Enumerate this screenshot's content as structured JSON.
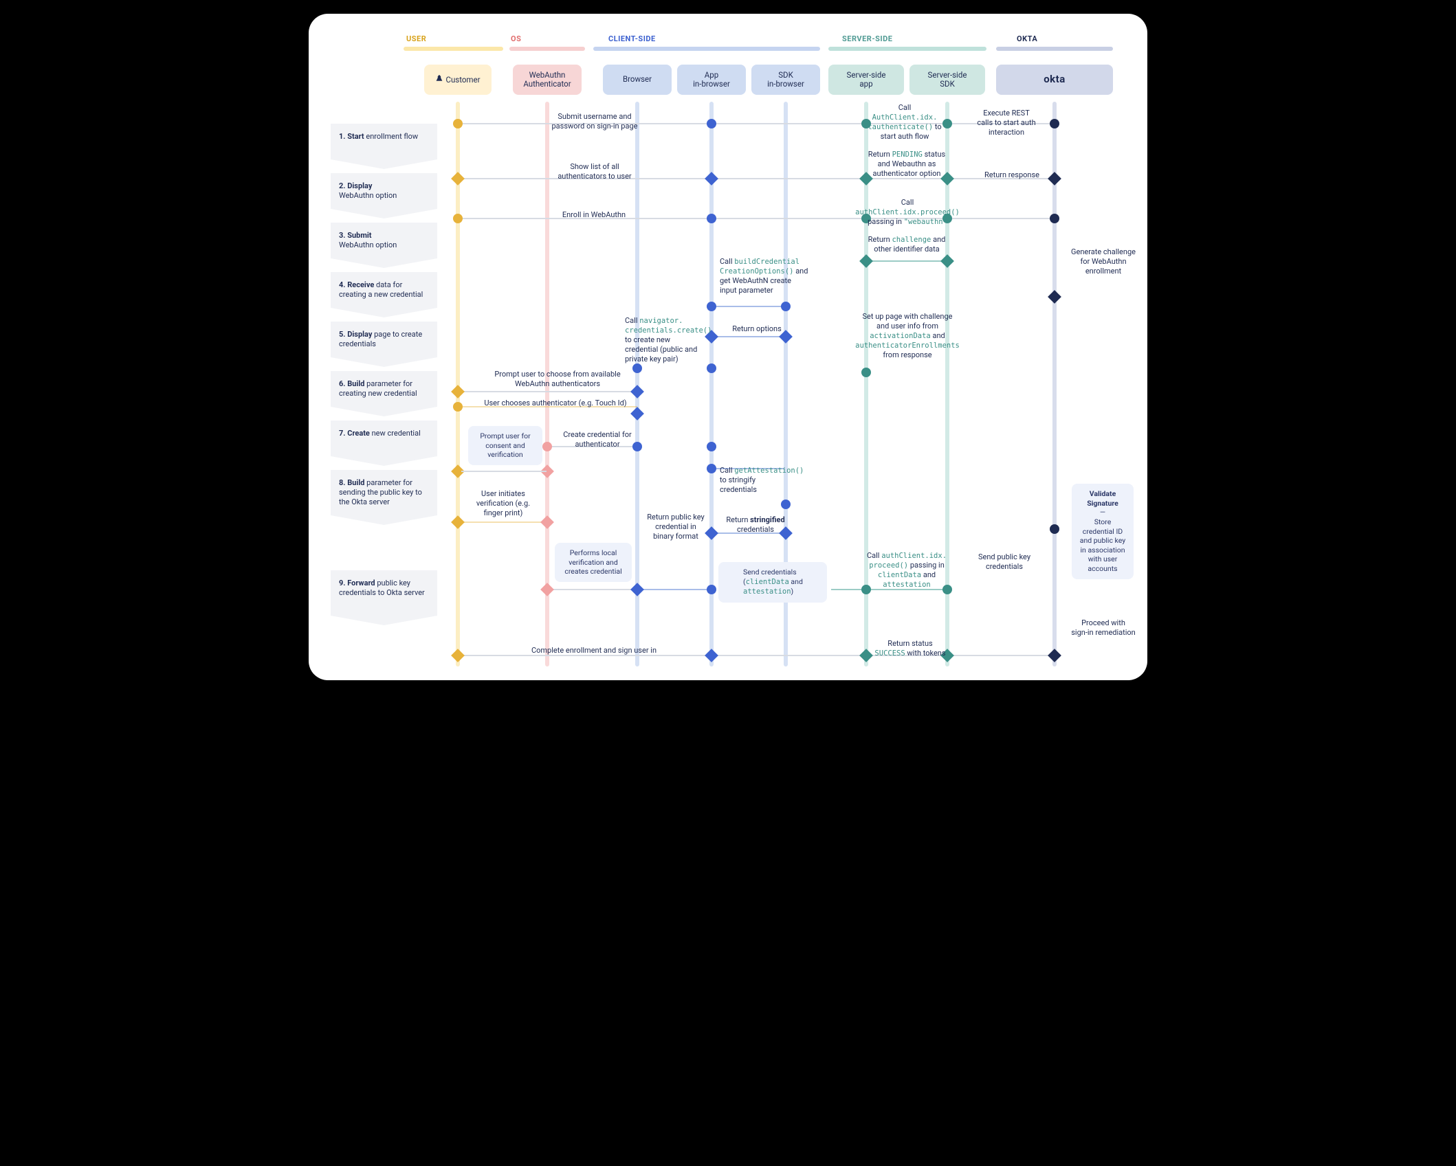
{
  "sections": {
    "user": {
      "label": "USER"
    },
    "os": {
      "label": "OS"
    },
    "client": {
      "label": "CLIENT-SIDE"
    },
    "server": {
      "label": "SERVER-SIDE"
    },
    "okta": {
      "label": "OKTA"
    }
  },
  "lanes": {
    "customer": {
      "label1": "Customer",
      "label2": ""
    },
    "webauthn": {
      "label1": "WebAuthn",
      "label2": "Authenticator"
    },
    "browser": {
      "label1": "Browser",
      "label2": ""
    },
    "app": {
      "label1": "App",
      "label2": "in-browser"
    },
    "sdk": {
      "label1": "SDK",
      "label2": "in-browser"
    },
    "serverapp": {
      "label1": "Server-side",
      "label2": "app"
    },
    "serversdk": {
      "label1": "Server-side",
      "label2": "SDK"
    },
    "okta": {
      "label1": "okta",
      "label2": ""
    }
  },
  "steps": [
    {
      "num": "1.",
      "bold": "Start",
      "rest": " enrollment flow"
    },
    {
      "num": "2.",
      "bold": "Display",
      "rest": " WebAuthn option"
    },
    {
      "num": "3.",
      "bold": "Submit",
      "rest": " WebAuthn option"
    },
    {
      "num": "4.",
      "bold": "Receive",
      "rest": " data for creating a new credential"
    },
    {
      "num": "5.",
      "bold": "Display",
      "rest": " page to create credentials"
    },
    {
      "num": "6.",
      "bold": "Build",
      "rest": " parameter for creating new credential"
    },
    {
      "num": "7.",
      "bold": "Create",
      "rest": " new credential"
    },
    {
      "num": "8.",
      "bold": "Build",
      "rest": " parameter for sending the public key to the Okta server"
    },
    {
      "num": "9.",
      "bold": "Forward",
      "rest": " public key credentials to Okta server"
    }
  ],
  "ann": {
    "a1": {
      "t1": "Submit username and",
      "t2": "password on sign-in page"
    },
    "a2": {
      "t1": "Call",
      "c1": "AuthClient.idx.",
      "c2": "tauthenticate()",
      "t2": " to",
      "t3": "start auth flow"
    },
    "a3": {
      "t1": "Execute REST",
      "t2": "calls to start auth",
      "t3": "interaction"
    },
    "a4": {
      "t1": "Return ",
      "c1": "PENDING",
      "t2": " status",
      "t3": "and Webauthn as",
      "t4": "authenticator option"
    },
    "a5": {
      "t1": "Show list of all",
      "t2": "authenticators to user"
    },
    "a6": {
      "t1": "Return response"
    },
    "a7": {
      "t1": "Enroll in WebAuthn"
    },
    "a8": {
      "t1": "Call ",
      "c1": "authClient.idx.proceed()",
      "t2": "passing in ",
      "c2": "\"webauthn\""
    },
    "a9": {
      "t1": "Generate challenge",
      "t2": "for WebAuthn",
      "t3": "enrollment"
    },
    "a10": {
      "t1": "Return ",
      "c1": "challenge",
      "t2": " and",
      "t3": "other identifier data"
    },
    "a11": {
      "t1": "Call ",
      "c1": "buildCredential",
      "c2": "CreationOptions()",
      "t2": " and",
      "t3": "get WebAuthN create",
      "t4": "input parameter"
    },
    "a12": {
      "t1": "Set up page with challenge",
      "t2": "and user info from",
      "c1": "activationData",
      "t3": " and",
      "c2": "authenticatorEnrollments",
      "t4": "from response"
    },
    "a13": {
      "t1": "Return options"
    },
    "a14": {
      "t1": "Call ",
      "c1": "navigator.",
      "c2": "credentials.create()",
      "t2": "to create new",
      "t3": "credential (public and",
      "t4": "private key pair)"
    },
    "a15": {
      "t1": "Prompt user to choose from available",
      "t2": "WebAuthn authenticators"
    },
    "a16": {
      "t1": "User chooses authenticator (e.g. Touch Id)"
    },
    "a17": {
      "t1": "Create credential for",
      "t2": "authenticator"
    },
    "a18": {
      "t1": "User initiates",
      "t2": "verification (e.g.",
      "t3": "finger print)"
    },
    "a19": {
      "t1": "Return public key",
      "t2": "credential in",
      "t3": "binary format"
    },
    "a20": {
      "t1": "Call ",
      "c1": "getAttestation()",
      "t2": "to stringify",
      "t3": "credentials"
    },
    "a21": {
      "t1": "Return ",
      "b1": "stringified",
      "t2": "credentials"
    },
    "a22": {
      "t1": "Call ",
      "c1": "authClient.idx.",
      "c2": "proceed()",
      "t2": " passing in",
      "c3": "clientData",
      "t3": " and",
      "c4": "attestation"
    },
    "a23": {
      "t1": "Send public key",
      "t2": "credentials"
    },
    "a24": {
      "t1": "Return status",
      "c1": "SUCCESS",
      "t2": " with tokens"
    },
    "a25": {
      "t1": "Proceed with",
      "t2": "sign-in remediation"
    },
    "a26": {
      "t1": "Complete enrollment and sign user in"
    }
  },
  "notes": {
    "n1": {
      "t1": "Prompt user for",
      "t2": "consent and",
      "t3": "verification"
    },
    "n2": {
      "t1": "Performs local",
      "t2": "verification and",
      "t3": "creates credential"
    },
    "n3": {
      "t1": "Send credentials",
      "t2a": "(",
      "c1": "clientData",
      "t2b": " and ",
      "c2": "attestation",
      "t2c": ")"
    },
    "n4": {
      "b1": "Validate",
      "b2": "Signature",
      "t1": "—",
      "t2": "Store",
      "t3": "credential ID",
      "t4": "and public key",
      "t5": "in association",
      "t6": "with user",
      "t7": "accounts"
    }
  },
  "colors": {
    "user": "#e7b23a",
    "os": "#f1a1a1",
    "client": "#3e63d1",
    "server": "#3a8f86",
    "okta": "#1f2b52"
  }
}
